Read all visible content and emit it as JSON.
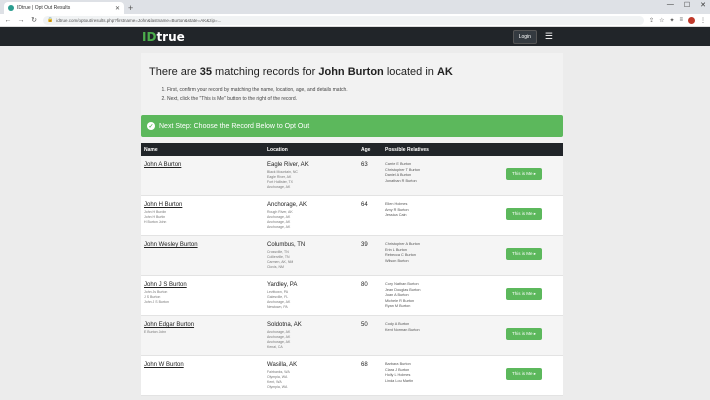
{
  "browser": {
    "tab_title": "IDtrue | Opt Out Results",
    "url": "idtrue.com/optout/results.php?firstname=John&lastname=Burton&state=AK&zip=..."
  },
  "site": {
    "brand_id": "ID",
    "brand_rest": "true",
    "login_label": "Login"
  },
  "header": {
    "prefix": "There are ",
    "count": "35",
    "middle": " matching records for ",
    "name": "John Burton",
    "located": " located in ",
    "state": "AK",
    "steps": [
      "First, confirm your record by matching the name, location, age, and details match.",
      "Next, click the \"This is Me\" button to the right of the record."
    ]
  },
  "next_step": "Next Step: Choose the Record Below to Opt Out",
  "table": {
    "headers": [
      "Name",
      "Location",
      "Age",
      "Possible Relatives"
    ],
    "button_label": "This is Me ▸",
    "rows": [
      {
        "name": "John A Burton",
        "aka": [],
        "location": "Eagle River, AK",
        "other_locations": [
          "Black Mountain, NC",
          "Eagle River, AK",
          "Fort Hollister, TX",
          "Anchorage, AK"
        ],
        "age": "63",
        "relatives": [
          "Carrie E Burton",
          "Christopher T Burton",
          "Daniel A Burton",
          "Jonathan R Burton"
        ]
      },
      {
        "name": "John H Burton",
        "aka": [
          "John H Burdin",
          "John H Burtin",
          "H Burton John"
        ],
        "location": "Anchorage, AK",
        "other_locations": [
          "Rough River, AK",
          "Anchorage, AK",
          "Anchorage, AK",
          "Anchorage, AK"
        ],
        "age": "64",
        "relatives": [
          "Ellen Holmes",
          "Amy R Burton",
          "Jessica Cain"
        ]
      },
      {
        "name": "John Wesley Burton",
        "aka": [],
        "location": "Columbus, TN",
        "other_locations": [
          "Crossville, TN",
          "Collierville, TN",
          "Carmen, AK, NM",
          "Clovis, NM"
        ],
        "age": "39",
        "relatives": [
          "Christopher A Burton",
          "Erin L Burton",
          "Rebecca C Burton",
          "Wilson Burton"
        ]
      },
      {
        "name": "John J S Burton",
        "aka": [
          "John Js Burton",
          "J S Burton",
          "John J S Burton"
        ],
        "location": "Yardley, PA",
        "other_locations": [
          "Levittown, PA",
          "Galesville, FL",
          "Anchorage, AK",
          "Newtown, PA"
        ],
        "age": "80",
        "relatives": [
          "Cory Nathan Burton",
          "Jean Douglas Burton",
          "Joan A Burton",
          "Michele R Burton",
          "Ryan M Burton"
        ]
      },
      {
        "name": "John Edgar Burton",
        "aka": [
          "E Burton John"
        ],
        "location": "Soldotna, AK",
        "other_locations": [
          "Anchorage, AK",
          "Anchorage, AK",
          "Anchorage, AK",
          "Kenai, CA"
        ],
        "age": "50",
        "relatives": [
          "Cody A Burton",
          "Kent Norman Burton"
        ]
      },
      {
        "name": "John W Burton",
        "aka": [],
        "location": "Wasilla, AK",
        "other_locations": [
          "Fairbanks, WA",
          "Olympia, WA",
          "Kent, WA",
          "Olympia, WA"
        ],
        "age": "68",
        "relatives": [
          "Barbara Burton",
          "Clara J Burton",
          "Holly L Holmes",
          "Linda Lou Martin"
        ]
      }
    ]
  }
}
